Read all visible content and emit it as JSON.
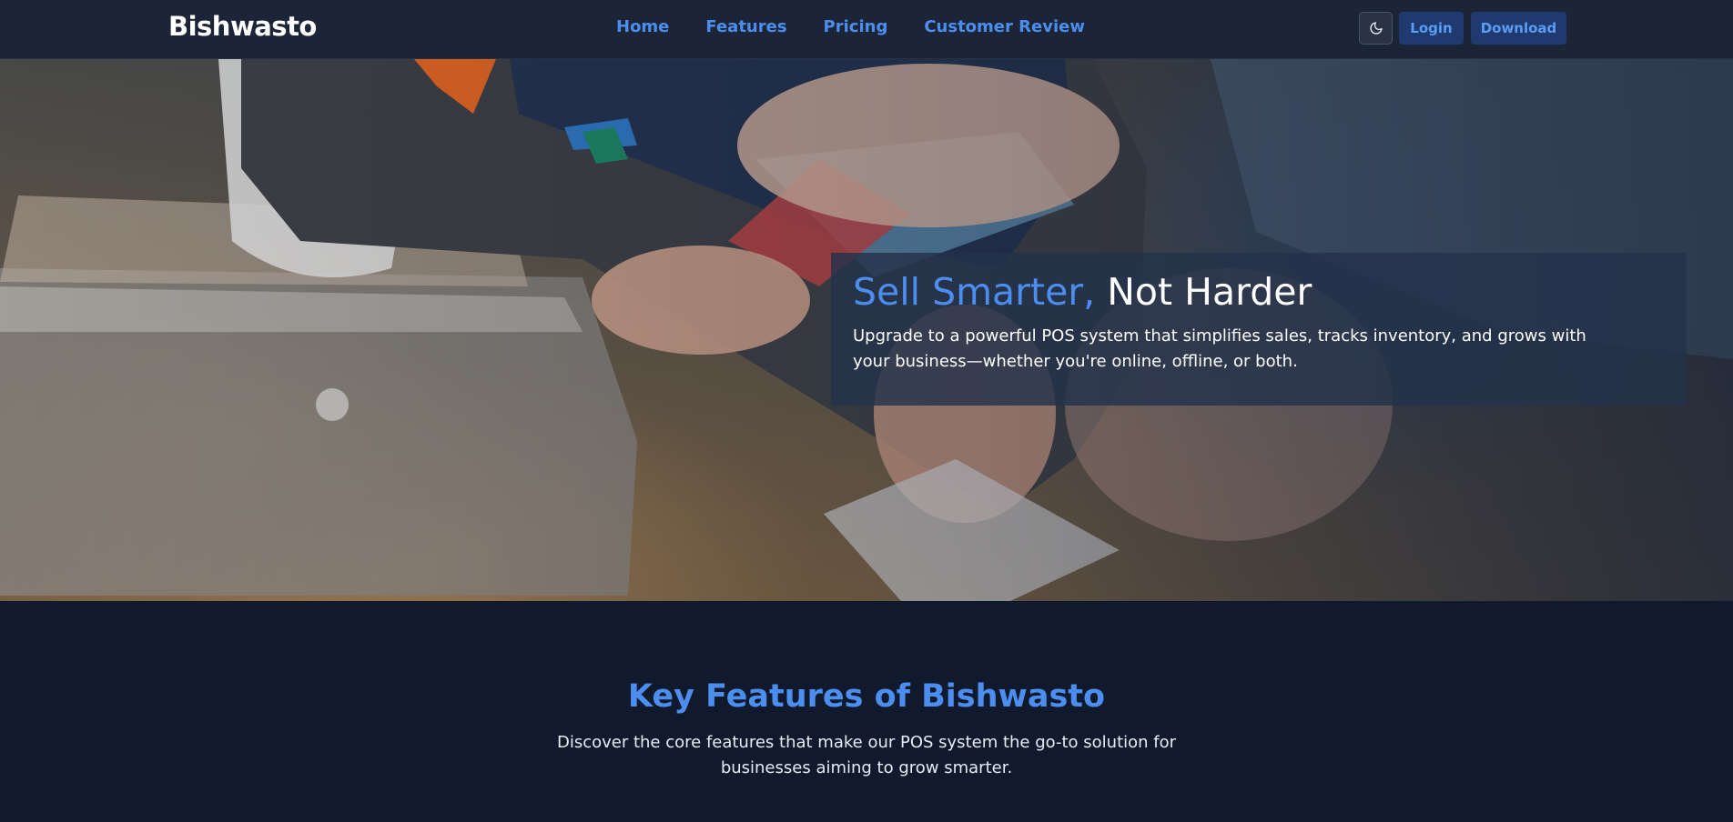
{
  "navbar": {
    "brand": "Bishwasto",
    "links": [
      "Home",
      "Features",
      "Pricing",
      "Customer Review"
    ],
    "theme_toggle_icon": "moon-icon",
    "login_label": "Login",
    "download_label": "Download"
  },
  "hero": {
    "title_accent": "Sell Smarter,",
    "title_plain": "Not Harder",
    "subtitle": "Upgrade to a powerful POS system that simplifies sales, tracks inventory, and grows with your business—whether you're online, offline, or both."
  },
  "features": {
    "title": "Key Features of Bishwasto",
    "subtitle": "Discover the core features that make our POS system the go-to solution for businesses aiming to grow smarter."
  },
  "colors": {
    "accent": "#4b8ef0",
    "navbar_bg": "#1c2537",
    "page_bg": "#111a2c",
    "button_bg": "#1e3a6e"
  }
}
